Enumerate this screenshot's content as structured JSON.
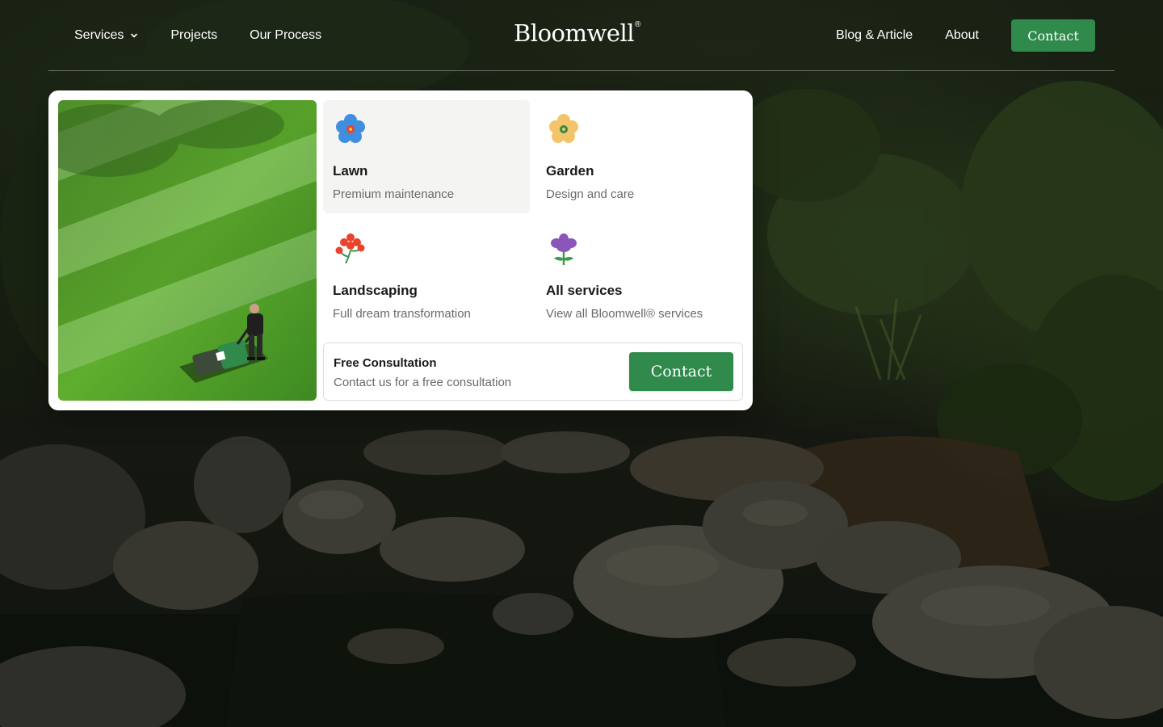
{
  "brand": {
    "name": "Bloomwell",
    "mark": "®"
  },
  "nav": {
    "left": [
      {
        "label": "Services",
        "has_dropdown": true
      },
      {
        "label": "Projects"
      },
      {
        "label": "Our Process"
      }
    ],
    "right": [
      {
        "label": "Blog & Article"
      },
      {
        "label": "About"
      }
    ],
    "contact_label": "Contact"
  },
  "dropdown": {
    "services": [
      {
        "title": "Lawn",
        "subtitle": "Premium maintenance",
        "icon": "blue-flower-icon",
        "active": true
      },
      {
        "title": "Garden",
        "subtitle": "Design and care",
        "icon": "yellow-flower-icon"
      },
      {
        "title": "Landscaping",
        "subtitle": "Full dream transformation",
        "icon": "red-flower-icon"
      },
      {
        "title": "All services",
        "subtitle": "View all Bloomwell® services",
        "icon": "purple-flower-icon"
      }
    ],
    "consultation": {
      "title": "Free Consultation",
      "subtitle": "Contact us for a free consultation",
      "button_label": "Contact"
    }
  },
  "colors": {
    "accent_green": "#2f8a4c",
    "panel_bg": "#ffffff",
    "active_card_bg": "#f4f4f3",
    "muted_text": "#6a6a66"
  }
}
